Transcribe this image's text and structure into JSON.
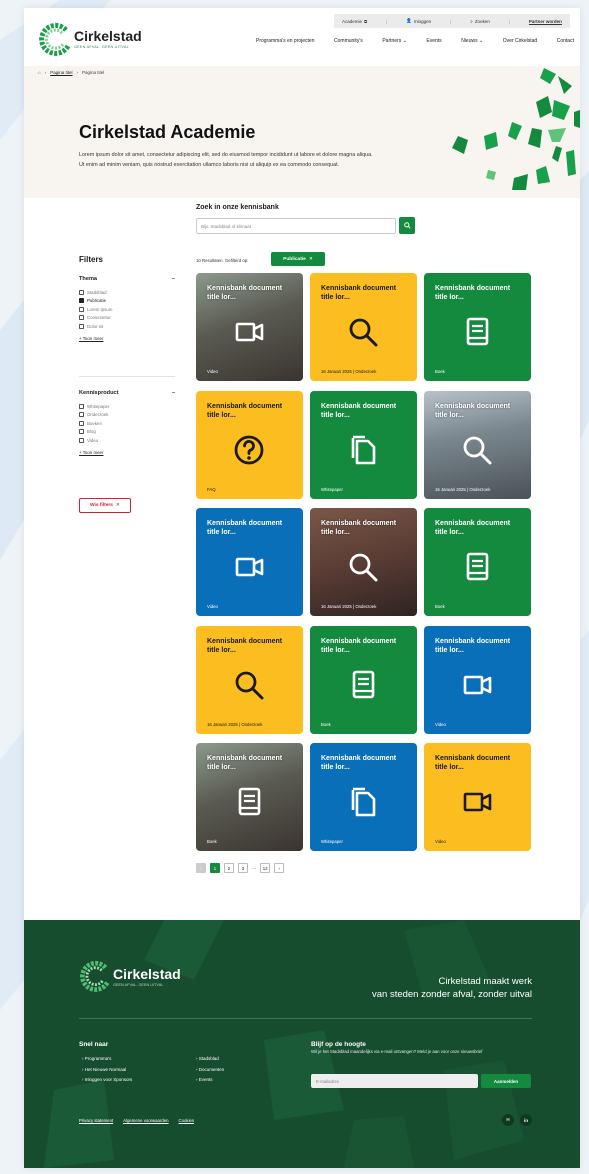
{
  "header": {
    "util": {
      "academie": "Academie",
      "inloggen": "Inloggen",
      "zoeken": "Zoeken",
      "partner": "Partner worden"
    },
    "logo": {
      "name": "Cirkelstad",
      "tagline": "GEEN AFVAL. GEEN UITVAL"
    },
    "nav": [
      "Programma's en projecten",
      "Community's",
      "Partners ⌄",
      "Events",
      "Nieuws ⌄",
      "Over Cirkelstad",
      "Contact"
    ]
  },
  "breadcrumb": {
    "link": "Pagina titel",
    "current": "Pagina titel"
  },
  "hero": {
    "title": "Cirkelstad Academie",
    "intro": "Lorem ipsum dolor sit amet, consectetur adipiscing elit, sed do eiusmod tempor incididunt ut labore et dolore magna aliqua. Ut enim ad minim veniam, quis nostrud exercitation ullamco laboris nisi ut aliquip ex ea commodo consequat."
  },
  "search": {
    "title": "Zoek in onze kennisbank",
    "placeholder": "Bijv. Stadsblad of klimaat",
    "count": "10 Resultaten. Gefilterd op:",
    "active_filter": "Publicatie",
    "remove": "✕"
  },
  "filters": {
    "title": "Filters",
    "thema": {
      "heading": "Thema",
      "options": [
        "Stadsblad",
        "Publicatie",
        "Lorem ipsum",
        "Consectetur",
        "Dolor sit"
      ],
      "checked": 1,
      "more": "+ Toon meer"
    },
    "kennisproduct": {
      "heading": "Kennisproduct",
      "options": [
        "Whitepaper",
        "Onderzoek",
        "Boeken",
        "Blog",
        "Video"
      ],
      "more": "+ Toon meer"
    },
    "clear": "Wis filters"
  },
  "cards": [
    {
      "style": "photo",
      "title": "Kennisbank document title lor...",
      "icon": "video-icon",
      "meta": "Video"
    },
    {
      "style": "yellow",
      "title": "Kennisbank document title lor...",
      "icon": "search-icon",
      "meta": "16 Januari 2025  |  Onderzoek"
    },
    {
      "style": "green",
      "title": "Kennisbank document title lor...",
      "icon": "book-icon",
      "meta": "Boek"
    },
    {
      "style": "yellow",
      "title": "Kennisbank document title lor...",
      "icon": "question-icon",
      "meta": "FAQ"
    },
    {
      "style": "green",
      "title": "Kennisbank document title lor...",
      "icon": "document-icon",
      "meta": "Whitepaper"
    },
    {
      "style": "photo2",
      "title": "Kennisbank document title lor...",
      "icon": "search-icon",
      "meta": "16 Januari 2025  |  Onderzoek"
    },
    {
      "style": "blue",
      "title": "Kennisbank document title lor...",
      "icon": "video-icon",
      "meta": "Video"
    },
    {
      "style": "photo3",
      "title": "Kennisbank document title lor...",
      "icon": "search-icon",
      "meta": "16 Januari 2025  |  Onderzoek"
    },
    {
      "style": "green",
      "title": "Kennisbank document title lor...",
      "icon": "book-icon",
      "meta": "Boek"
    },
    {
      "style": "yellow",
      "title": "Kennisbank document title lor...",
      "icon": "search-icon",
      "meta": "16 Januari 2025  |  Onderzoek"
    },
    {
      "style": "green",
      "title": "Kennisbank document title lor...",
      "icon": "book-icon",
      "meta": "Boek"
    },
    {
      "style": "blue",
      "title": "Kennisbank document title lor...",
      "icon": "video-icon",
      "meta": "Video"
    },
    {
      "style": "photo",
      "title": "Kennisbank document title lor...",
      "icon": "book-icon",
      "meta": "Boek"
    },
    {
      "style": "blue",
      "title": "Kennisbank document title lor...",
      "icon": "document-icon",
      "meta": "Whitepaper"
    },
    {
      "style": "yellow",
      "title": "Kennisbank document title lor...",
      "icon": "video-icon",
      "meta": "Video"
    }
  ],
  "pagination": {
    "prev": "‹",
    "pages": [
      "1",
      "2",
      "3"
    ],
    "dots": "...",
    "last": "12",
    "next": "›",
    "current": "1"
  },
  "footer": {
    "logo": {
      "name": "Cirkelstad",
      "tagline": "GEEN AFVAL. GEEN UITVAL"
    },
    "slogan_line1": "Cirkelstad maakt werk",
    "slogan_line2": "van steden zonder afval, zonder uitval",
    "snel_naar": "Snel naar",
    "links_col1": [
      "Programma's",
      "Het Nieuwe Normaal",
      "Inloggen voor Sponsors"
    ],
    "links_col2": [
      "Stadsblad",
      "Documenten",
      "Events"
    ],
    "newsletter_title": "Blijf op de hoogte",
    "newsletter_text": "Wil je het Stadsblad maandelijks via e-mail ontvangen? Meld je aan voor onze nieuwsbrief",
    "email_placeholder": "E-mailadres",
    "subscribe": "Aanmelden",
    "legal": [
      "Privacy statement",
      "Algemene voorwaarden",
      "Cookies"
    ],
    "social": [
      "✉",
      "in"
    ]
  },
  "colors": {
    "green": "#138a3e",
    "yellow": "#fbbd20",
    "blue": "#0a6fb9",
    "footer": "#164d2e",
    "red": "#d5202d"
  }
}
